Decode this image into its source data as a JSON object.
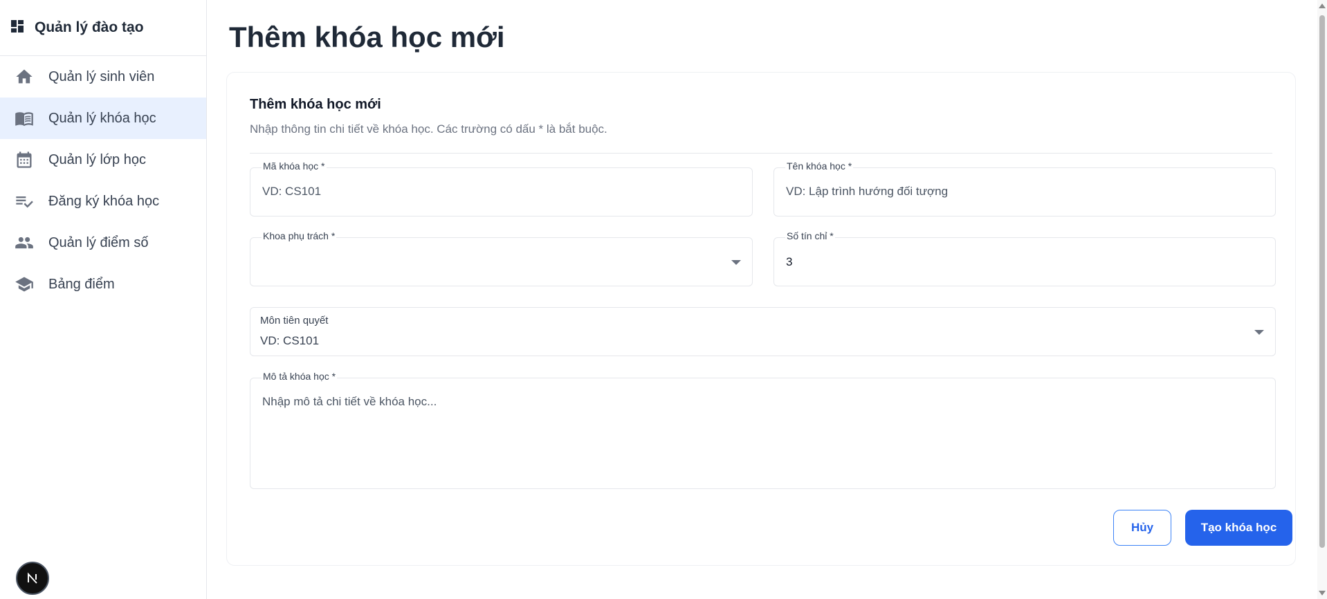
{
  "app": {
    "brand_title": "Quản lý đào tạo",
    "brand_icon": "dashboard-icon",
    "avatar_letter": "N"
  },
  "sidebar": {
    "items": [
      {
        "label": "Quản lý sinh viên",
        "icon": "home-icon",
        "active": false
      },
      {
        "label": "Quản lý khóa học",
        "icon": "book-icon",
        "active": true
      },
      {
        "label": "Quản lý lớp học",
        "icon": "calendar-icon",
        "active": false
      },
      {
        "label": "Đăng ký khóa học",
        "icon": "checklist-icon",
        "active": false
      },
      {
        "label": "Quản lý điểm số",
        "icon": "people-icon",
        "active": false
      },
      {
        "label": "Bảng điểm",
        "icon": "school-icon",
        "active": false
      }
    ]
  },
  "page": {
    "title": "Thêm khóa học mới"
  },
  "form": {
    "title": "Thêm khóa học mới",
    "description": "Nhập thông tin chi tiết về khóa học. Các trường có dấu * là bắt buộc.",
    "course_code": {
      "label": "Mã khóa học *",
      "placeholder": "VD: CS101"
    },
    "course_name": {
      "label": "Tên khóa học *",
      "placeholder": "VD: Lập trình hướng đối tượng"
    },
    "department": {
      "label": "Khoa phụ trách *",
      "value": ""
    },
    "credits": {
      "label": "Số tín chỉ *",
      "value": "3"
    },
    "prerequisite": {
      "label": "Môn tiên quyết",
      "value": "VD: CS101"
    },
    "description_field": {
      "label": "Mô tả khóa học *",
      "placeholder": "Nhập mô tả chi tiết về khóa học..."
    },
    "cancel_label": "Hủy",
    "submit_label": "Tạo khóa học"
  },
  "colors": {
    "accent": "#2563eb",
    "active_nav_bg": "#e8f0fe"
  }
}
